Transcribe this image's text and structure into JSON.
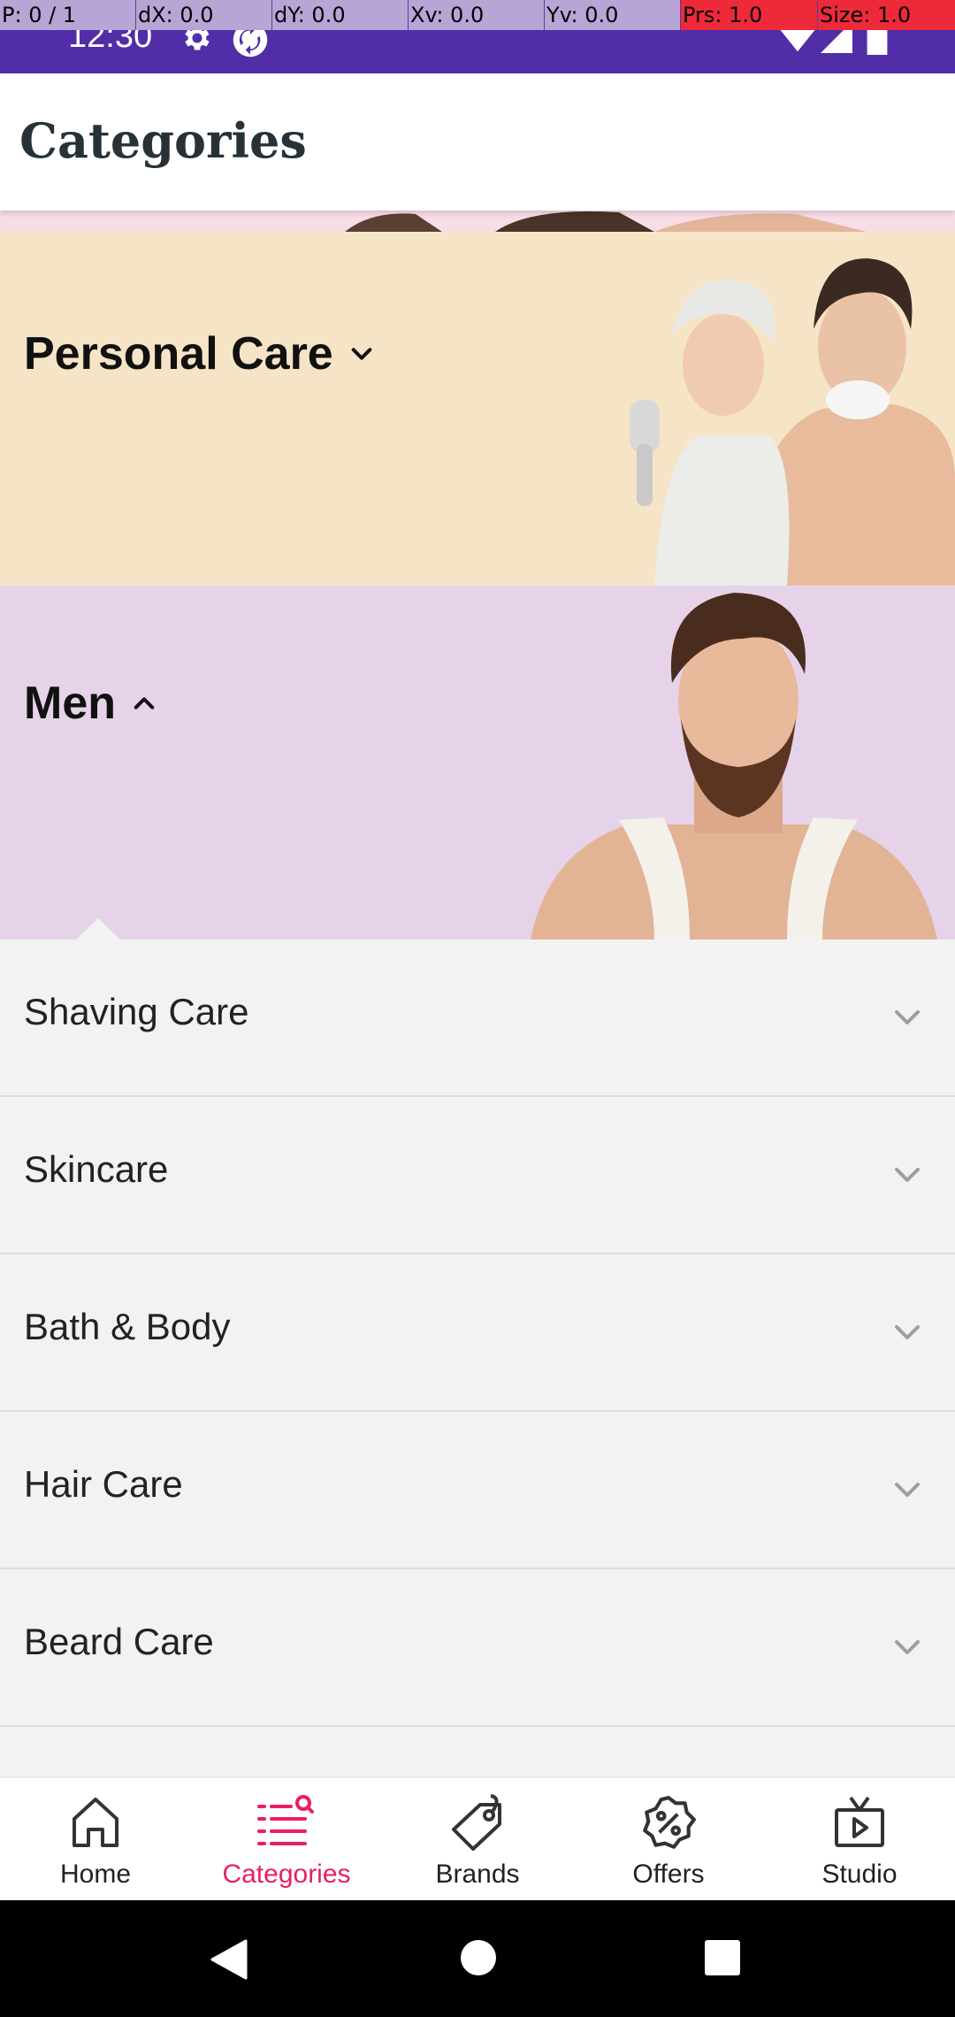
{
  "debug": {
    "p": "P: 0 / 1",
    "dx": "dX: 0.0",
    "dy": "dY: 0.0",
    "xv": "Xv: 0.0",
    "yv": "Yv: 0.0",
    "prs": "Prs: 1.0",
    "size": "Size: 1.0"
  },
  "status_bar": {
    "time": "12:30",
    "icons": [
      "gear-icon",
      "sync-icon",
      "wifi-icon",
      "signal-icon",
      "battery-icon"
    ]
  },
  "app_bar": {
    "title": "Categories"
  },
  "categories": [
    {
      "label": "Personal Care",
      "expanded": false,
      "bg": "#f6e4c6"
    },
    {
      "label": "Men",
      "expanded": true,
      "bg": "#e6d3ea"
    }
  ],
  "men_subcategories": [
    {
      "label": "Shaving Care"
    },
    {
      "label": "Skincare"
    },
    {
      "label": "Bath & Body"
    },
    {
      "label": "Hair Care"
    },
    {
      "label": "Beard Care"
    }
  ],
  "bottom_nav": {
    "active": "Categories",
    "items": [
      {
        "label": "Home",
        "icon": "home-icon"
      },
      {
        "label": "Categories",
        "icon": "categories-search-icon"
      },
      {
        "label": "Brands",
        "icon": "tag-icon"
      },
      {
        "label": "Offers",
        "icon": "percent-badge-icon"
      },
      {
        "label": "Studio",
        "icon": "tv-play-icon"
      }
    ]
  },
  "colors": {
    "status_bar": "#512da8",
    "accent": "#e91e63",
    "title": "#263238"
  }
}
